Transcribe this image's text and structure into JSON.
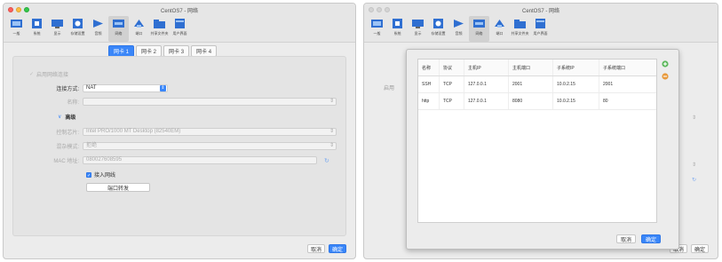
{
  "left_window": {
    "title": "CentOS7 - 网络",
    "toolbar": [
      {
        "label": "一般",
        "icon": "general-icon"
      },
      {
        "label": "系统",
        "icon": "system-icon"
      },
      {
        "label": "显示",
        "icon": "display-icon"
      },
      {
        "label": "存储设置",
        "icon": "storage-icon"
      },
      {
        "label": "音频",
        "icon": "audio-icon"
      },
      {
        "label": "网络",
        "icon": "network-icon"
      },
      {
        "label": "端口",
        "icon": "ports-icon"
      },
      {
        "label": "共享文件夹",
        "icon": "shared-folders-icon"
      },
      {
        "label": "用户界面",
        "icon": "user-interface-icon"
      }
    ],
    "tabs": [
      "网卡 1",
      "网卡 2",
      "网卡 3",
      "网卡 4"
    ],
    "enable_label": "启用网络连接",
    "attached_label": "连接方式:",
    "attached_value": "NAT",
    "name_label": "名称:",
    "advanced_label": "高级",
    "adapter_type_label": "控制芯片:",
    "adapter_type_value": "Intel PRO/1000 MT Desktop (82540EM)",
    "promisc_label": "混杂模式:",
    "promisc_value": "拒绝",
    "mac_label": "MAC 地址:",
    "mac_value": "080027608595",
    "cable_label": "接入网线",
    "port_forward_label": "端口转发",
    "cancel_label": "取消",
    "ok_label": "确定"
  },
  "right_window": {
    "title": "CentOS7 - 网络",
    "toolbar": [
      {
        "label": "一般",
        "icon": "general-icon"
      },
      {
        "label": "系统",
        "icon": "system-icon"
      },
      {
        "label": "显示",
        "icon": "display-icon"
      },
      {
        "label": "存储设置",
        "icon": "storage-icon"
      },
      {
        "label": "音频",
        "icon": "audio-icon"
      },
      {
        "label": "网络",
        "icon": "network-icon"
      },
      {
        "label": "端口",
        "icon": "ports-icon"
      },
      {
        "label": "共享文件夹",
        "icon": "shared-folders-icon"
      },
      {
        "label": "用户界面",
        "icon": "user-interface-icon"
      }
    ],
    "ghost_label": "启用",
    "dialog": {
      "columns": [
        "名称",
        "协议",
        "主机IP",
        "主机端口",
        "子系统IP",
        "子系统端口"
      ],
      "rows": [
        [
          "SSH",
          "TCP",
          "127.0.0.1",
          "2001",
          "10.0.2.15",
          "2001"
        ],
        [
          "http",
          "TCP",
          "127.0.0.1",
          "8080",
          "10.0.2.15",
          "80"
        ]
      ],
      "add_icon": "add-rule-icon",
      "remove_icon": "remove-rule-icon",
      "cancel_label": "取消",
      "ok_label": "确定"
    },
    "cancel_label": "取消",
    "ok_label": "确定"
  },
  "colors": {
    "accent": "#3a86f8",
    "window_bg": "#ececec",
    "toolbar_bg": "#e6e6e6"
  }
}
